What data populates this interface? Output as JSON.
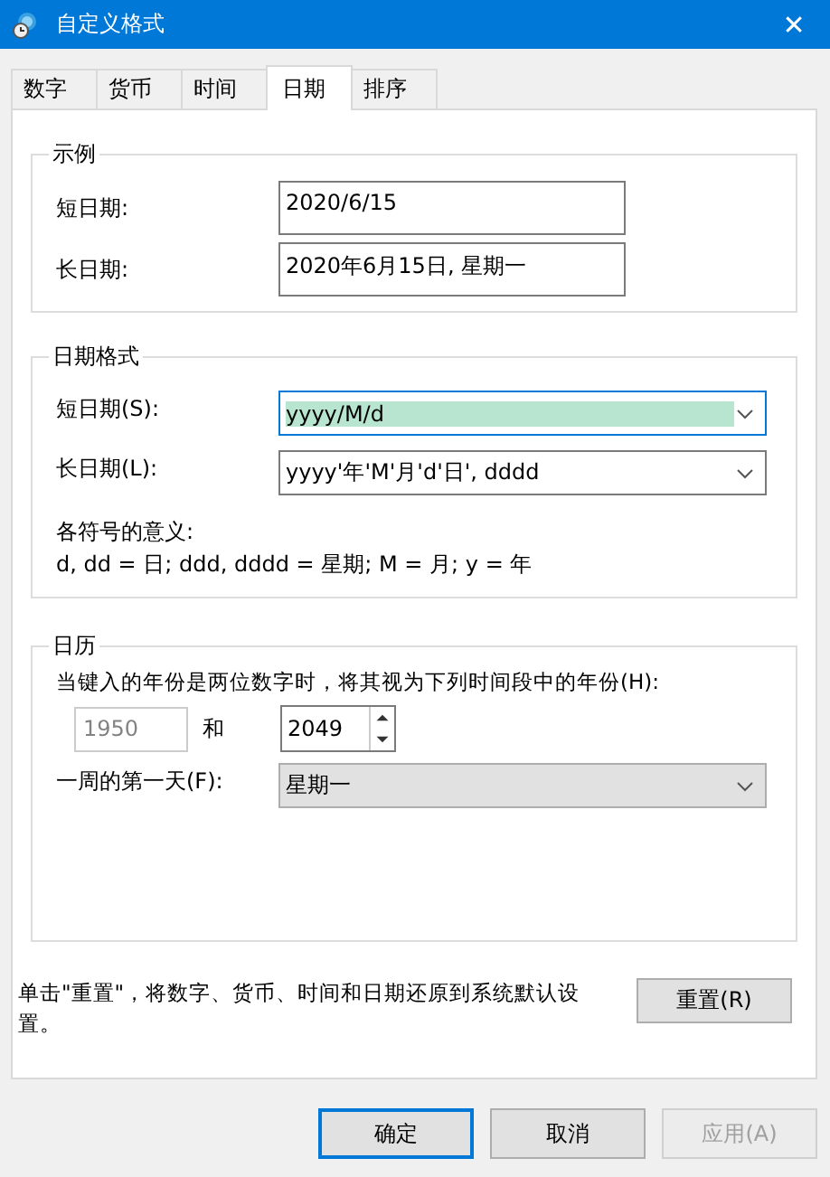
{
  "window": {
    "title": "自定义格式",
    "close": "✕"
  },
  "tabs": [
    {
      "label": "数字",
      "selected": false
    },
    {
      "label": "货币",
      "selected": false
    },
    {
      "label": "时间",
      "selected": false
    },
    {
      "label": "日期",
      "selected": true
    },
    {
      "label": "排序",
      "selected": false
    }
  ],
  "example": {
    "title": "示例",
    "rows": [
      {
        "label": "短日期:",
        "value": "2020/6/15"
      },
      {
        "label": "长日期:",
        "value": "2020年6月15日, 星期一"
      }
    ]
  },
  "date_format": {
    "title": "日期格式",
    "rows": [
      {
        "label": "短日期(S):",
        "value": "yyyy/M/d",
        "focused": true
      },
      {
        "label": "长日期(L):",
        "value": "yyyy'年'M'月'd'日', dddd",
        "focused": false
      }
    ],
    "legend_title": "各符号的意义:",
    "legend": "d, dd = 日;  ddd, dddd = 星期;  M = 月;  y = 年"
  },
  "calendar": {
    "title": "日历",
    "two_digit_label": "当键入的年份是两位数字时，将其视为下列时间段中的年份(H):",
    "from_year": {
      "value": "1950",
      "disabled": true
    },
    "and": "和",
    "to_year": "2049",
    "first_day_label": "一周的第一天(F):",
    "first_day": "星期一"
  },
  "reset_note": "单击\"重置\"，将数字、货币、时间和日期还原到系统默认设置。",
  "reset_button": "重置(R)",
  "buttons": [
    {
      "label": "确定",
      "default": true,
      "disabled": false
    },
    {
      "label": "取消",
      "default": false,
      "disabled": false
    },
    {
      "label": "应用(A)",
      "default": false,
      "disabled": true
    }
  ]
}
